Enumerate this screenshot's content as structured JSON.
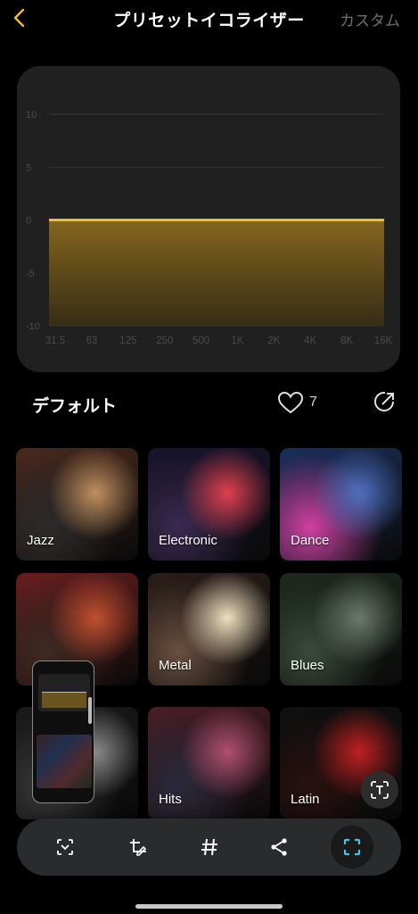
{
  "header": {
    "title": "プリセットイコライザー",
    "custom_label": "カスタム"
  },
  "chart_data": {
    "type": "area",
    "x": [
      "31.5",
      "63",
      "125",
      "250",
      "500",
      "1K",
      "2K",
      "4K",
      "8K",
      "16K"
    ],
    "y_ticks": [
      "10",
      "5",
      "0",
      "-5",
      "-10"
    ],
    "ylim": [
      -10,
      10
    ],
    "values": [
      0,
      0,
      0,
      0,
      0,
      0,
      0,
      0,
      0,
      0
    ],
    "grid": true,
    "line_color": "#f3b93b"
  },
  "preset": {
    "name": "デフォルト",
    "likes": "7"
  },
  "genres": [
    {
      "label": "Jazz",
      "tone": [
        "#4a2a1e",
        "#2b2b2b",
        "#c09060"
      ]
    },
    {
      "label": "Electronic",
      "tone": [
        "#1a1530",
        "#3b2a50",
        "#e04050"
      ]
    },
    {
      "label": "Dance",
      "tone": [
        "#1b2f5a",
        "#d040a0",
        "#5070c0"
      ]
    },
    {
      "label": "",
      "tone": [
        "#6a1e1e",
        "#3c2a22",
        "#c05030"
      ]
    },
    {
      "label": "Metal",
      "tone": [
        "#2a1e18",
        "#6a5040",
        "#f0e0c0"
      ]
    },
    {
      "label": "Blues",
      "tone": [
        "#1e2a1e",
        "#3a4a3a",
        "#6a7a6a"
      ]
    },
    {
      "label": "",
      "tone": [
        "#1a1a1a",
        "#3a3a3a",
        "#8a8a8a"
      ]
    },
    {
      "label": "Hits",
      "tone": [
        "#4a1e2a",
        "#2a2a3a",
        "#b05070"
      ]
    },
    {
      "label": "Latin",
      "tone": [
        "#101010",
        "#2a1010",
        "#c02020"
      ]
    }
  ],
  "toolbar": {
    "items": [
      "scan-text-icon",
      "edit-crop-icon",
      "hashtag-icon",
      "share-icon",
      "focus-icon"
    ],
    "accent": "#3fc6e8"
  },
  "colors": {
    "background": "#000000",
    "card": "#202020",
    "accent": "#f3b93b"
  }
}
